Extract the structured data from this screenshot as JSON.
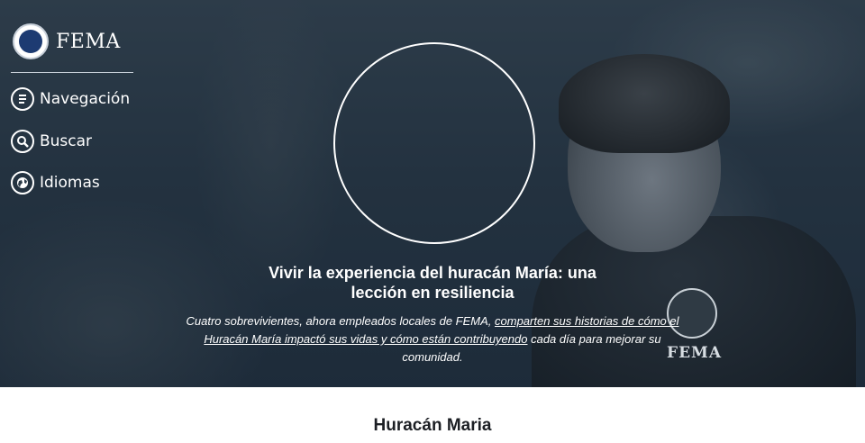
{
  "brand": {
    "name": "FEMA",
    "seal_icon": "dhs-seal-icon"
  },
  "nav": [
    {
      "label": "Navegación",
      "icon": "menu-icon"
    },
    {
      "label": "Buscar",
      "icon": "search-icon"
    },
    {
      "label": "Idiomas",
      "icon": "globe-icon"
    }
  ],
  "hero": {
    "title": "Vivir la experiencia del huracán María: una lección en resiliencia",
    "desc_before": "Cuatro sobrevivientes, ahora empleados locales de FEMA, ",
    "desc_link": "comparten sus historias de cómo el Huracán María impactó sus vidas y cómo están contribuyendo",
    "desc_after": " cada día para mejorar su comunidad.",
    "photo_badge_text": "FEMA"
  },
  "section": {
    "heading": "Huracán Maria"
  },
  "colors": {
    "overlay": "#142132",
    "text": "#ffffff",
    "heading": "#1c1f24"
  }
}
